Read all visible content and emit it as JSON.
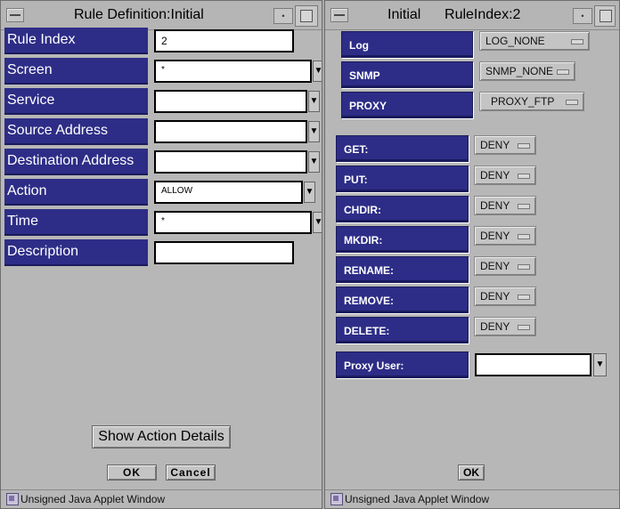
{
  "left_window": {
    "title": "Rule Definition:Initial",
    "fields": [
      {
        "label": "Rule Index",
        "value": "2"
      },
      {
        "label": "Screen",
        "value": "*"
      },
      {
        "label": "Service",
        "value": ""
      },
      {
        "label": "Source Address",
        "value": ""
      },
      {
        "label": "Destination Address",
        "value": ""
      },
      {
        "label": "Action",
        "value": "ALLOW"
      },
      {
        "label": "Time",
        "value": "*"
      },
      {
        "label": "Description",
        "value": ""
      }
    ],
    "show_action_details": "Show Action Details",
    "ok": "OK",
    "cancel": "Cancel",
    "status": "Unsigned Java Applet Window"
  },
  "right_window": {
    "title": "Initial      RuleIndex:2",
    "top_rows": [
      {
        "label": "Log",
        "value": "LOG_NONE"
      },
      {
        "label": "SNMP",
        "value": "SNMP_NONE"
      },
      {
        "label": "PROXY",
        "value": "PROXY_FTP"
      }
    ],
    "commands": [
      {
        "label": "GET:",
        "value": "DENY"
      },
      {
        "label": "PUT:",
        "value": "DENY"
      },
      {
        "label": "CHDIR:",
        "value": "DENY"
      },
      {
        "label": "MKDIR:",
        "value": "DENY"
      },
      {
        "label": "RENAME:",
        "value": "DENY"
      },
      {
        "label": "REMOVE:",
        "value": "DENY"
      },
      {
        "label": "DELETE:",
        "value": "DENY"
      }
    ],
    "proxy_user_label": "Proxy User:",
    "proxy_user_value": "",
    "ok": "OK",
    "status": "Unsigned Java Applet Window"
  },
  "colors": {
    "label_bg": "#2d2d87",
    "window_bg": "#b7b7b7"
  }
}
